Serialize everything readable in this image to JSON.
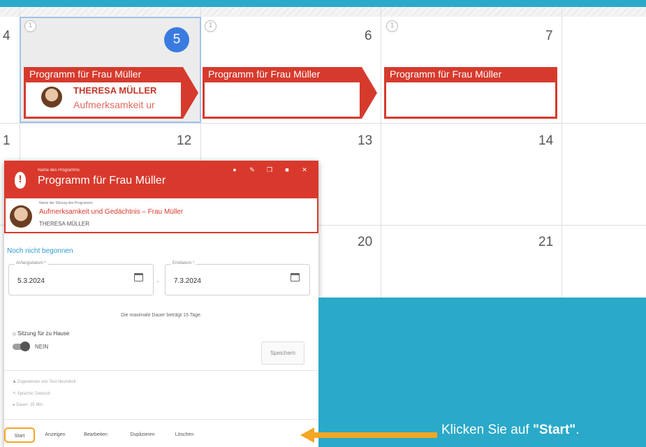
{
  "calendar": {
    "row1": {
      "prev_day": "4",
      "days": [
        {
          "number": "5",
          "count": "1",
          "today": true
        },
        {
          "number": "6",
          "count": "1"
        },
        {
          "number": "7",
          "count": "1"
        }
      ]
    },
    "row2": [
      "1",
      "12",
      "13",
      "14"
    ],
    "row3": [
      "20",
      "21"
    ],
    "event": {
      "title": "Programm für Frau Müller",
      "patient": "THERESA MÜLLER",
      "session": "Aufmerksamkeit ur"
    }
  },
  "popup": {
    "program_label": "Name des Programms",
    "program_name": "Programm für Frau Müller",
    "session_label": "Name der Sitzung des Programms",
    "session_name": "Aufmerksamkeit und Gedächtnis – Frau Müller",
    "person": "THERESA MÜLLER",
    "status": "Noch nicht begonnen",
    "start_label": "Anfangsdatum *",
    "start_date": "5.3.2024",
    "end_label": "Enddatum *",
    "end_date": "7.3.2024",
    "date_separator": "-",
    "hint": "Die maximale Dauer beträgt 15 Tage.",
    "home_label": "Sitzung für zu Hause",
    "toggle_value": "NEIN",
    "save": "Speichern",
    "meta": [
      "Zugewiesen von Test Neurokoll",
      "Sprache: Deutsch",
      "Dauer: 25 Min"
    ],
    "footer": [
      "Start",
      "Anzeigen",
      "Bearbeiten",
      "Duplizieren",
      "Löschen"
    ]
  },
  "callout": {
    "prefix": "Klicken Sie auf ",
    "emphasis": "\"Start\"",
    "suffix": "."
  },
  "colors": {
    "brand_red": "#d9392c",
    "teal": "#2aa9c9",
    "highlight": "#f5a623",
    "today_blue": "#3a7be0"
  }
}
